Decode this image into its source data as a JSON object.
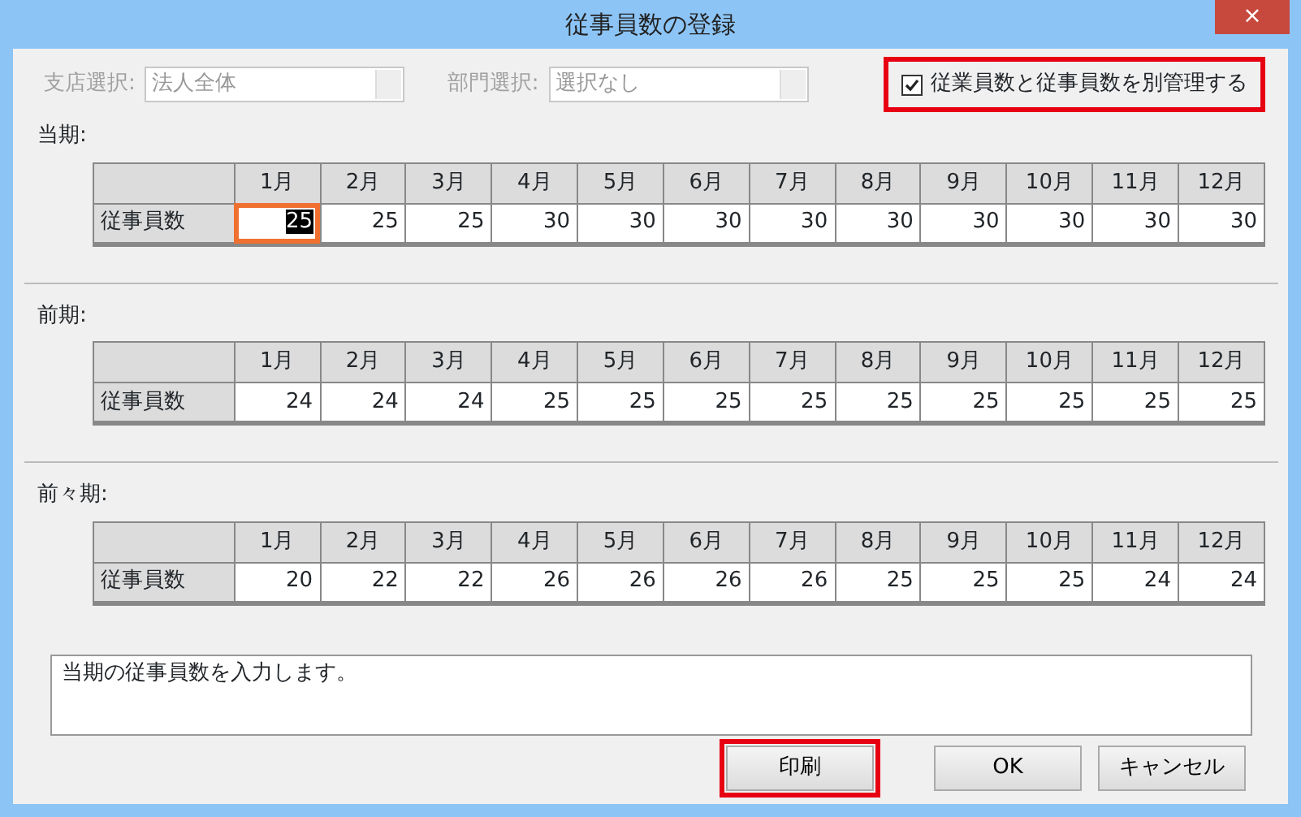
{
  "window": {
    "title": "従事員数の登録",
    "close": "×"
  },
  "filters": [
    {
      "label": "支店選択:",
      "value": "法人全体",
      "disabled": true
    },
    {
      "label": "部門選択:",
      "value": "選択なし",
      "disabled": true
    }
  ],
  "separate_checkbox": {
    "label": "従業員数と従事員数を別管理する",
    "checked": true,
    "highlighted": true
  },
  "sections": [
    {
      "label": "当期:",
      "columns": [
        "1月",
        "2月",
        "3月",
        "4月",
        "5月",
        "6月",
        "7月",
        "8月",
        "9月",
        "10月",
        "11月",
        "12月"
      ],
      "row_label": "従事員数",
      "cells": [
        {
          "value": "25",
          "selected": true
        },
        {
          "value": "25",
          "selected": false
        },
        {
          "value": "25",
          "selected": false
        },
        {
          "value": "30",
          "selected": false
        },
        {
          "value": "30",
          "selected": false
        },
        {
          "value": "30",
          "selected": false
        },
        {
          "value": "30",
          "selected": false
        },
        {
          "value": "30",
          "selected": false
        },
        {
          "value": "30",
          "selected": false
        },
        {
          "value": "30",
          "selected": false
        },
        {
          "value": "30",
          "selected": false
        },
        {
          "value": "30",
          "selected": false
        }
      ]
    },
    {
      "label": "前期:",
      "columns": [
        "1月",
        "2月",
        "3月",
        "4月",
        "5月",
        "6月",
        "7月",
        "8月",
        "9月",
        "10月",
        "11月",
        "12月"
      ],
      "row_label": "従事員数",
      "cells": [
        {
          "value": "24",
          "selected": false
        },
        {
          "value": "24",
          "selected": false
        },
        {
          "value": "24",
          "selected": false
        },
        {
          "value": "25",
          "selected": false
        },
        {
          "value": "25",
          "selected": false
        },
        {
          "value": "25",
          "selected": false
        },
        {
          "value": "25",
          "selected": false
        },
        {
          "value": "25",
          "selected": false
        },
        {
          "value": "25",
          "selected": false
        },
        {
          "value": "25",
          "selected": false
        },
        {
          "value": "25",
          "selected": false
        },
        {
          "value": "25",
          "selected": false
        }
      ]
    },
    {
      "label": "前々期:",
      "columns": [
        "1月",
        "2月",
        "3月",
        "4月",
        "5月",
        "6月",
        "7月",
        "8月",
        "9月",
        "10月",
        "11月",
        "12月"
      ],
      "row_label": "従事員数",
      "cells": [
        {
          "value": "20",
          "selected": false
        },
        {
          "value": "22",
          "selected": false
        },
        {
          "value": "22",
          "selected": false
        },
        {
          "value": "26",
          "selected": false
        },
        {
          "value": "26",
          "selected": false
        },
        {
          "value": "26",
          "selected": false
        },
        {
          "value": "26",
          "selected": false
        },
        {
          "value": "25",
          "selected": false
        },
        {
          "value": "25",
          "selected": false
        },
        {
          "value": "25",
          "selected": false
        },
        {
          "value": "24",
          "selected": false
        },
        {
          "value": "24",
          "selected": false
        }
      ]
    }
  ],
  "message": "当期の従事員数を入力します。",
  "buttons": [
    {
      "label": "印刷",
      "highlighted": true
    },
    {
      "label": "OK",
      "highlighted": false
    },
    {
      "label": "キャンセル",
      "highlighted": false
    }
  ]
}
